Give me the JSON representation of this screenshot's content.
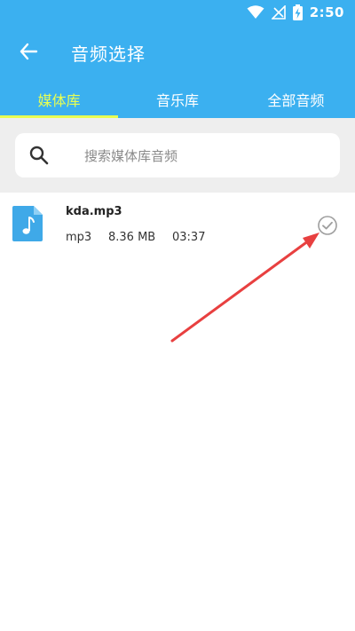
{
  "status_bar": {
    "time": "2:50",
    "icons": [
      "wifi-icon",
      "no-signal-icon",
      "battery-charging-icon"
    ]
  },
  "toolbar": {
    "back_icon": "arrow-left-icon",
    "title": "音频选择"
  },
  "tabs": [
    {
      "label": "媒体库",
      "active": true
    },
    {
      "label": "音乐库",
      "active": false
    },
    {
      "label": "全部音频",
      "active": false
    }
  ],
  "search": {
    "icon": "search-icon",
    "placeholder": "搜索媒体库音频"
  },
  "files": [
    {
      "icon": "audio-file-icon",
      "name": "kda.mp3",
      "type": "mp3",
      "size": "8.36 MB",
      "duration": "03:37",
      "selected": false
    }
  ],
  "colors": {
    "header": "#3bb0f0",
    "active_tab": "#e8ff52",
    "annotation_arrow": "#e84040",
    "file_icon": "#3fa9e8"
  }
}
